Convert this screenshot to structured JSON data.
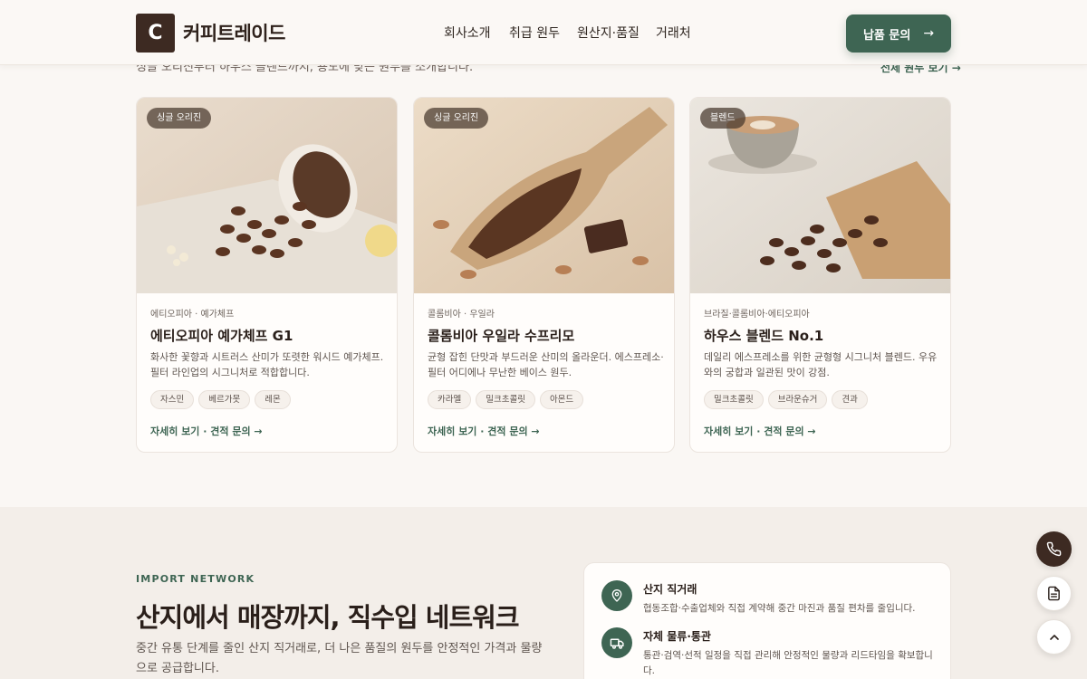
{
  "header": {
    "logo_letter": "C",
    "logo_text": "커피트레이드",
    "nav": [
      "회사소개",
      "취급 원두",
      "원산지·품질",
      "거래처"
    ],
    "cta_label": "납품 문의",
    "cta_arrow": "→"
  },
  "partial_section": {
    "subtitle_fragment": "싱글 오리진부터 하우스 블렌드까지, 용도에 맞는 원두를 소개합니다.",
    "all_beans_link": "전체 원두 보기 →"
  },
  "products": [
    {
      "badge": "싱글 오리진",
      "origin": "에티오피아 · 예가체프",
      "name": "에티오피아 예가체프 G1",
      "description": "화사한 꽃향과 시트러스 산미가 또렷한 워시드 예가체프. 필터 라인업의 시그니처로 적합합니다.",
      "tags": [
        "자스민",
        "베르가못",
        "레몬"
      ],
      "link": "자세히 보기 · 견적 문의 →"
    },
    {
      "badge": "싱글 오리진",
      "origin": "콜롬비아 · 우일라",
      "name": "콜롬비아 우일라 수프리모",
      "description": "균형 잡힌 단맛과 부드러운 산미의 올라운더. 에스프레소·필터 어디에나 무난한 베이스 원두.",
      "tags": [
        "카라멜",
        "밀크초콜릿",
        "아몬드"
      ],
      "link": "자세히 보기 · 견적 문의 →"
    },
    {
      "badge": "블렌드",
      "origin": "브라질·콜롬비아·에티오피아",
      "name": "하우스 블렌드 No.1",
      "description": "데일리 에스프레소를 위한 균형형 시그니처 블렌드. 우유와의 궁합과 일관된 맛이 강점.",
      "tags": [
        "밀크초콜릿",
        "브라운슈거",
        "견과"
      ],
      "link": "자세히 보기 · 견적 문의 →"
    }
  ],
  "network": {
    "eyebrow": "IMPORT NETWORK",
    "title": "산지에서 매장까지, 직수입 네트워크",
    "description": "중간 유통 단계를 줄인 산지 직거래로, 더 나은 품질의 원두를 안정적인 가격과 물량으로 공급합니다.",
    "features": [
      {
        "icon": "map-pin-icon",
        "title": "산지 직거래",
        "description": "협동조합·수출업체와 직접 계약해 중간 마진과 품질 편차를 줄입니다."
      },
      {
        "icon": "truck-icon",
        "title": "자체 물류·통관",
        "description": "통관·검역·선적 일정을 직접 관리해 안정적인 물량과 리드타임을 확보합니다."
      }
    ]
  },
  "floating_buttons": [
    "phone-icon",
    "document-icon",
    "chevron-up-icon"
  ],
  "colors": {
    "brand_dark": "#3d2a22",
    "accent_green": "#3e6553",
    "page_bg": "#faf7f4",
    "section_bg": "#f3eee9"
  }
}
